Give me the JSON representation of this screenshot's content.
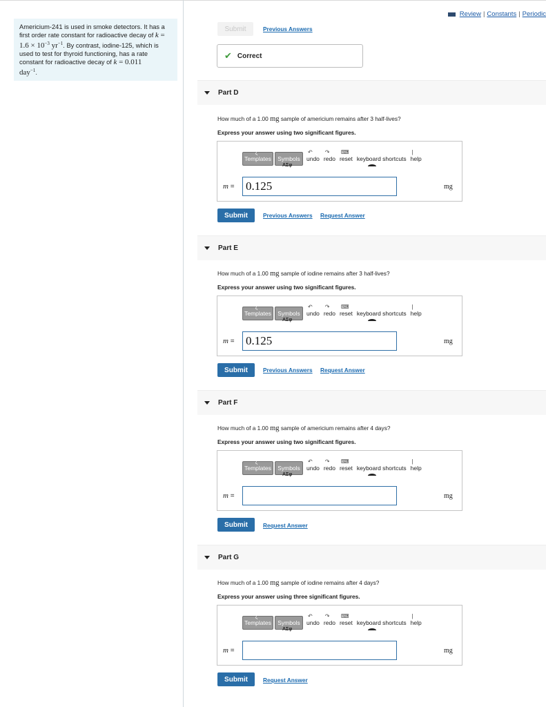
{
  "intro": {
    "t1": "Americium-241 is used in smoke detectors. It has a first order rate constant for radioactive decay of ",
    "k1_sym": "k",
    "k1_val": " = 1.6 × 10",
    "k1_exp": "−3",
    "k1_unit": " yr",
    "k1_unit_exp": "−1",
    "t2": ". By contrast, iodine-125, which is used to test for thyroid functioning, has a rate constant for radioactive decay of ",
    "k2_sym": "k",
    "k2_val": " = 0.011",
    "k2_unit": "day",
    "k2_unit_exp": "−1",
    "t3": "."
  },
  "toplinks": {
    "review": "Review",
    "sep": "|",
    "constants": "Constants",
    "periodic": "Periodic"
  },
  "prev_part": {
    "submit_label": "Submit",
    "prev_answers": "Previous Answers",
    "correct_text": "Correct"
  },
  "toolbar": {
    "templates": "Templates",
    "symbols": "Symbols",
    "undo": "undo",
    "redo": "redo",
    "reset": "reset",
    "shortcuts": "keyboard shortcuts",
    "help": "help"
  },
  "common": {
    "submit": "Submit",
    "previous_answers": "Previous Answers",
    "request_answer": "Request Answer",
    "var_label": "m",
    "equals": " =",
    "unit": "mg"
  },
  "parts": {
    "d": {
      "title": "Part D",
      "q_pre": "How much of a 1.00 ",
      "q_unit": "mg",
      "q_post": "  sample of americium remains after 3 half-lives?",
      "instr": "Express your answer using two significant figures.",
      "value": "0.125"
    },
    "e": {
      "title": "Part E",
      "q_pre": "How much of a 1.00 ",
      "q_unit": "mg",
      "q_post": " sample of iodine remains after 3 half-lives?",
      "instr": "Express your answer using two significant figures.",
      "value": "0.125"
    },
    "f": {
      "title": "Part F",
      "q_pre": "How much of a 1.00 ",
      "q_unit": "mg",
      "q_post": " sample of americium remains after 4 days?",
      "instr": "Express your answer using two significant figures.",
      "value": ""
    },
    "g": {
      "title": "Part G",
      "q_pre": "How much of a 1.00 ",
      "q_unit": "mg",
      "q_post": " sample of iodine remains after 4 days?",
      "instr": "Express your answer using three significant figures.",
      "value": ""
    }
  }
}
